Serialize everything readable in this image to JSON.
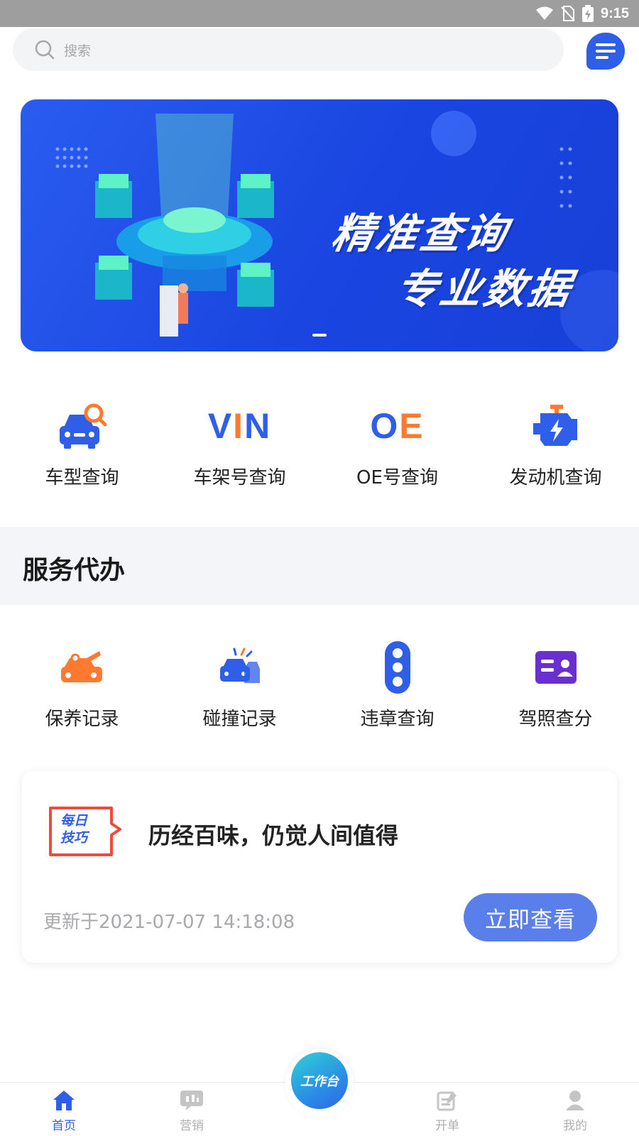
{
  "status_bar": {
    "time": "9:15",
    "icons": [
      "wifi-icon",
      "no-sim-icon",
      "battery-charging-icon"
    ]
  },
  "search": {
    "placeholder": "搜索",
    "icon": "search-icon"
  },
  "header": {
    "menu_icon": "menu-lines-icon",
    "accent": "#2f5ee8"
  },
  "banner": {
    "line1": "精准查询",
    "line2": "专业数据",
    "slide_count": 1,
    "active_slide": 1
  },
  "quick_actions": [
    {
      "label": "车型查询",
      "icon": "car-search-icon"
    },
    {
      "label": "车架号查询",
      "icon_text": "VIN"
    },
    {
      "label": "OE号查询",
      "icon_text": "OE"
    },
    {
      "label": "发动机查询",
      "icon": "engine-icon"
    }
  ],
  "services": {
    "title": "服务代办",
    "items": [
      {
        "label": "保养记录",
        "icon": "car-maintenance-icon",
        "color": "#ff7a2e"
      },
      {
        "label": "碰撞记录",
        "icon": "car-collision-icon",
        "color": "#2f5ee8"
      },
      {
        "label": "违章查询",
        "icon": "traffic-light-icon",
        "color": "#2f5ee8"
      },
      {
        "label": "驾照查分",
        "icon": "license-card-icon",
        "color": "#6a2fd0"
      }
    ]
  },
  "daily_tip": {
    "badge": [
      "每日",
      "技巧"
    ],
    "title": "历经百味，仍觉人间值得",
    "updated": "更新于2021-07-07 14:18:08",
    "button": "立即查看"
  },
  "tabbar": {
    "center": "工作台",
    "tabs": [
      {
        "label": "首页",
        "icon": "home-icon",
        "active": true
      },
      {
        "label": "营销",
        "icon": "marketing-icon",
        "active": false
      },
      {
        "label": "开单",
        "icon": "create-order-icon",
        "active": false
      },
      {
        "label": "我的",
        "icon": "profile-icon",
        "active": false
      }
    ]
  }
}
